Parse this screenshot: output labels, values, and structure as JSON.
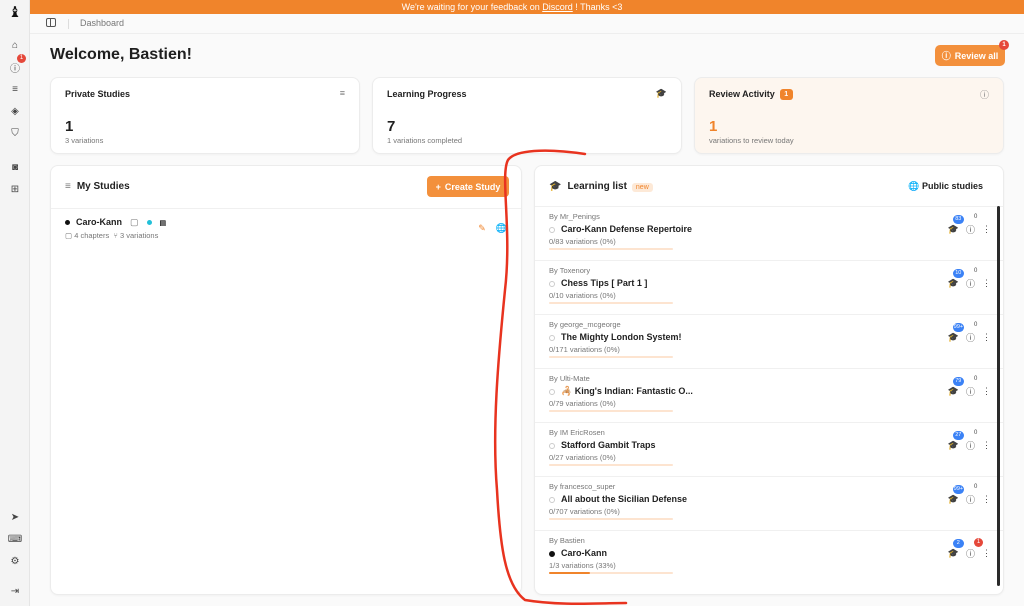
{
  "banner": {
    "text_before": "We're waiting for your feedback on ",
    "link": "Discord",
    "text_after": " ! Thanks <3"
  },
  "nav": {
    "notif_count": "1"
  },
  "breadcrumb": "Dashboard",
  "welcome": "Welcome, Bastien!",
  "review_all": {
    "label": "Review all",
    "badge": "1"
  },
  "stats": {
    "private": {
      "title": "Private Studies",
      "value": "1",
      "sub": "3 variations"
    },
    "progress": {
      "title": "Learning Progress",
      "value": "7",
      "sub": "1 variations completed"
    },
    "review": {
      "title": "Review Activity",
      "badge": "1",
      "value": "1",
      "sub": "variations to review today"
    }
  },
  "my_studies": {
    "title": "My Studies",
    "create_label": "Create Study",
    "study": {
      "name": "Caro-Kann",
      "chapters": "4 chapters",
      "variations": "3 variations"
    }
  },
  "learning": {
    "title": "Learning list",
    "new_tag": "new",
    "public_label": "Public studies",
    "items": [
      {
        "author": "By Mr_Penings",
        "title": "Caro-Kann Defense Repertoire",
        "progress": "0/83 variations (0%)",
        "count": "83",
        "review": "0",
        "pct": 0
      },
      {
        "author": "By Toxenory",
        "title": "Chess Tips [ Part 1 ]",
        "progress": "0/10 variations (0%)",
        "count": "10",
        "review": "0",
        "pct": 0
      },
      {
        "author": "By george_mcgeorge",
        "title": "The Mighty London System!",
        "progress": "0/171 variations (0%)",
        "count": "99+",
        "review": "0",
        "pct": 0
      },
      {
        "author": "By Ulti-Mate",
        "title": "🦂 King's Indian: Fantastic O...",
        "progress": "0/79 variations (0%)",
        "count": "79",
        "review": "0",
        "pct": 0
      },
      {
        "author": "By IM EricRosen",
        "title": "Stafford Gambit Traps",
        "progress": "0/27 variations (0%)",
        "count": "27",
        "review": "0",
        "pct": 0
      },
      {
        "author": "By francesco_super",
        "title": "All about the Sicilian Defense",
        "progress": "0/707 variations (0%)",
        "count": "99+",
        "review": "0",
        "pct": 0
      },
      {
        "author": "By Bastien",
        "title": "Caro-Kann",
        "progress": "1/3 variations (33%)",
        "count": "2",
        "review": "1",
        "pct": 33
      }
    ]
  },
  "colors": {
    "accent": "#f0842b",
    "annotation": "#e8331f"
  }
}
